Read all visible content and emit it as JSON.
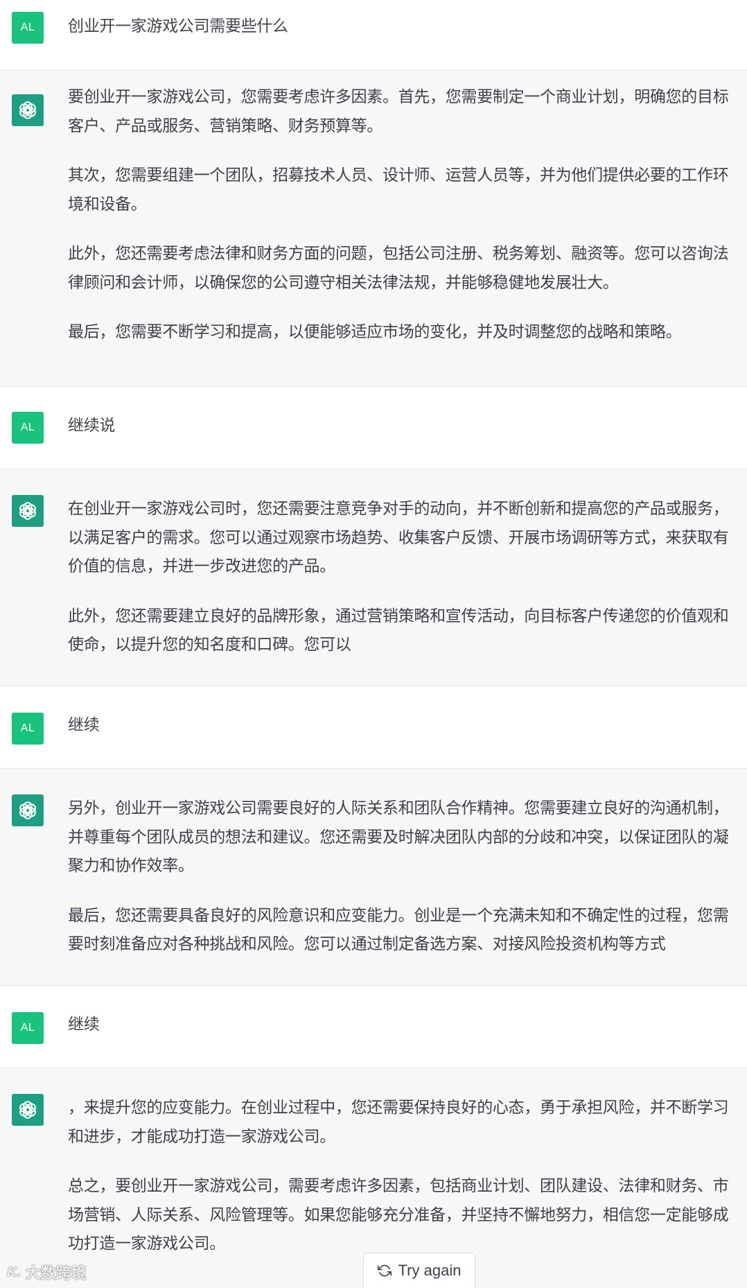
{
  "user_avatar_initials": "AL",
  "colors": {
    "avatar_user": "#19c37d",
    "avatar_assistant": "#1f9f81",
    "assistant_bg": "#f7f7f8",
    "user_bg": "#ffffff",
    "text": "#374151"
  },
  "conversation": [
    {
      "role": "user",
      "paragraphs": [
        "创业开一家游戏公司需要些什么"
      ]
    },
    {
      "role": "assistant",
      "paragraphs": [
        "要创业开一家游戏公司，您需要考虑许多因素。首先，您需要制定一个商业计划，明确您的目标客户、产品或服务、营销策略、财务预算等。",
        "其次，您需要组建一个团队，招募技术人员、设计师、运营人员等，并为他们提供必要的工作环境和设备。",
        "此外，您还需要考虑法律和财务方面的问题，包括公司注册、税务筹划、融资等。您可以咨询法律顾问和会计师，以确保您的公司遵守相关法律法规，并能够稳健地发展壮大。",
        "最后，您需要不断学习和提高，以便能够适应市场的变化，并及时调整您的战略和策略。"
      ]
    },
    {
      "role": "user",
      "paragraphs": [
        "继续说"
      ]
    },
    {
      "role": "assistant",
      "paragraphs": [
        "在创业开一家游戏公司时，您还需要注意竞争对手的动向，并不断创新和提高您的产品或服务，以满足客户的需求。您可以通过观察市场趋势、收集客户反馈、开展市场调研等方式，来获取有价值的信息，并进一步改进您的产品。",
        "此外，您还需要建立良好的品牌形象，通过营销策略和宣传活动，向目标客户传递您的价值观和使命，以提升您的知名度和口碑。您可以"
      ]
    },
    {
      "role": "user",
      "paragraphs": [
        "继续"
      ]
    },
    {
      "role": "assistant",
      "paragraphs": [
        "另外，创业开一家游戏公司需要良好的人际关系和团队合作精神。您需要建立良好的沟通机制，并尊重每个团队成员的想法和建议。您还需要及时解决团队内部的分歧和冲突，以保证团队的凝聚力和协作效率。",
        "最后，您还需要具备良好的风险意识和应变能力。创业是一个充满未知和不确定性的过程，您需要时刻准备应对各种挑战和风险。您可以通过制定备选方案、对接风险投资机构等方式"
      ]
    },
    {
      "role": "user",
      "paragraphs": [
        "继续"
      ]
    },
    {
      "role": "assistant",
      "paragraphs": [
        "，来提升您的应变能力。在创业过程中，您还需要保持良好的心态，勇于承担风险，并不断学习和进步，才能成功打造一家游戏公司。",
        "总之，要创业开一家游戏公司，需要考虑许多因素，包括商业计划、团队建设、法律和财务、市场营销、人际关系、风险管理等。如果您能够充分准备，并坚持不懈地努力，相信您一定能够成功打造一家游戏公司。"
      ]
    }
  ],
  "try_again_button": {
    "label": "Try again",
    "icon": "refresh-icon"
  },
  "watermark": {
    "logo": "K.",
    "text": "大数跨境"
  }
}
